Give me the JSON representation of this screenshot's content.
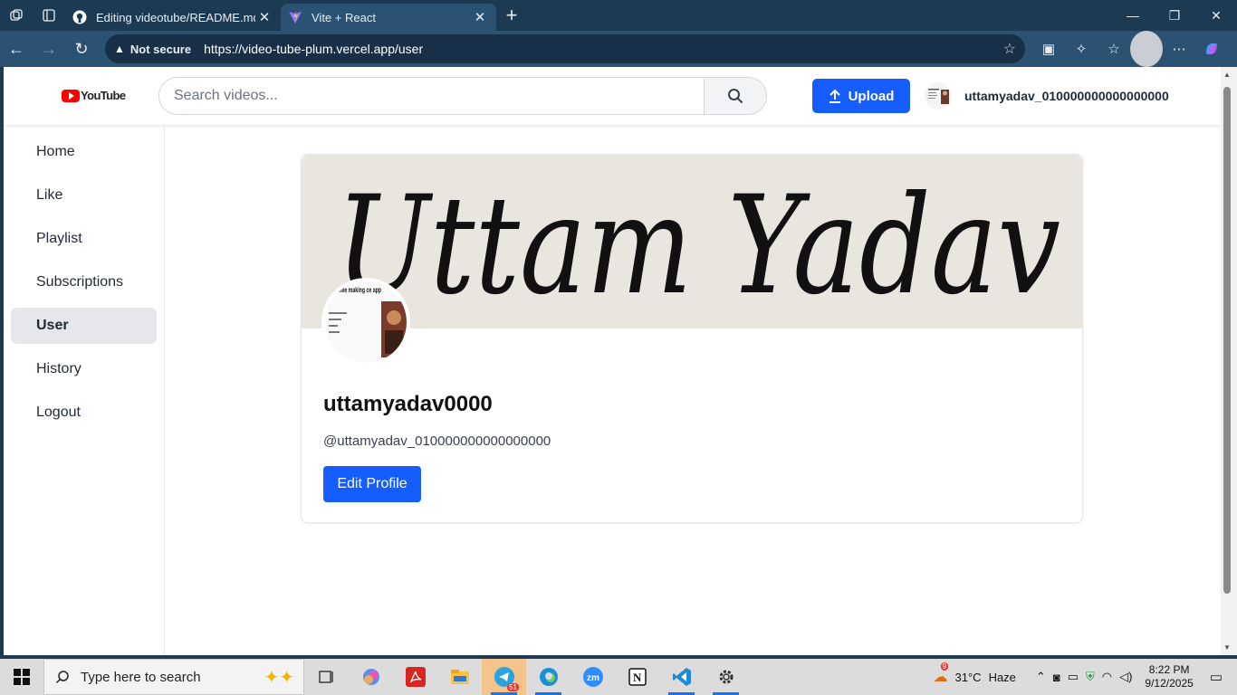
{
  "browser": {
    "tabs": [
      {
        "title": "Editing videotube/README.md at",
        "active": false
      },
      {
        "title": "Vite + React",
        "active": true
      }
    ],
    "security_label": "Not secure",
    "url": "https://video-tube-plum.vercel.app/user"
  },
  "header": {
    "logo_text": "YouTube",
    "search_placeholder": "Search videos...",
    "upload_label": "Upload",
    "username": "uttamyadav_010000000000000000"
  },
  "sidebar": {
    "items": [
      {
        "label": "Home"
      },
      {
        "label": "Like"
      },
      {
        "label": "Playlist"
      },
      {
        "label": "Subscriptions"
      },
      {
        "label": "User",
        "active": true
      },
      {
        "label": "History"
      },
      {
        "label": "Logout"
      }
    ]
  },
  "profile": {
    "cover_text": "Uttam Yadav",
    "avatar_text": "nts while making ce app",
    "display_name": "uttamyadav0000",
    "handle": "@uttamyadav_010000000000000000",
    "edit_label": "Edit Profile"
  },
  "taskbar": {
    "search_placeholder": "Type here to search",
    "telegram_badge": "51",
    "weather_badge": "9",
    "temperature": "31°C",
    "weather": "Haze",
    "time": "8:22 PM",
    "date": "9/12/2025"
  },
  "colors": {
    "accent": "#155dfc",
    "titlebar": "#1d3a53",
    "toolbar": "#2b5273",
    "active_sidebar": "#e5e7eb"
  }
}
